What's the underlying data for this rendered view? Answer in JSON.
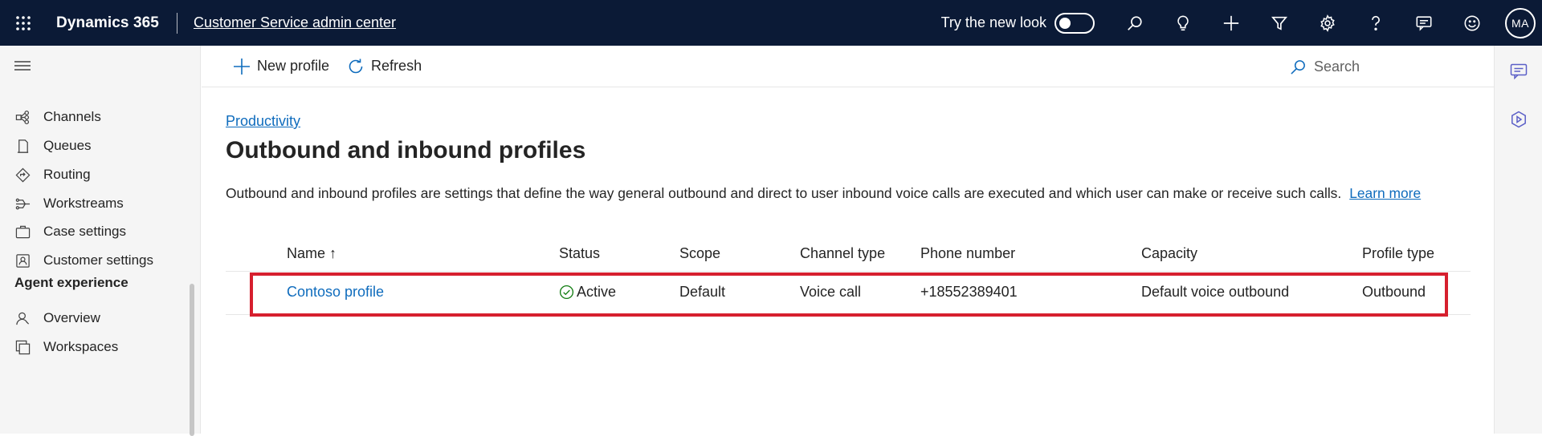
{
  "topbar": {
    "app_name": "Dynamics 365",
    "area_name": "Customer Service admin center",
    "try_new_look_label": "Try the new look",
    "try_new_look_on": false,
    "icons": [
      "search-icon",
      "lightbulb-icon",
      "plus-icon",
      "filter-icon",
      "settings-gear-icon",
      "help-icon",
      "chat-icon",
      "smiley-icon"
    ],
    "avatar_initials": "MA",
    "background_color": "#0b1a36"
  },
  "sidebar": {
    "items": [
      {
        "label": "Channels",
        "icon": "channels-icon"
      },
      {
        "label": "Queues",
        "icon": "queues-icon"
      },
      {
        "label": "Routing",
        "icon": "routing-icon"
      },
      {
        "label": "Workstreams",
        "icon": "workstreams-icon"
      },
      {
        "label": "Case settings",
        "icon": "case-settings-icon"
      },
      {
        "label": "Customer settings",
        "icon": "customer-settings-icon"
      }
    ],
    "section_agent_experience": "Agent experience",
    "agent_items": [
      {
        "label": "Overview",
        "icon": "overview-icon"
      },
      {
        "label": "Workspaces",
        "icon": "workspaces-icon"
      }
    ]
  },
  "commandbar": {
    "new_profile_label": "New profile",
    "refresh_label": "Refresh",
    "search_placeholder": "Search"
  },
  "main": {
    "breadcrumb": "Productivity",
    "title": "Outbound and inbound profiles",
    "description": "Outbound and inbound profiles are settings that define the way general outbound and direct to user inbound voice calls are executed and which user can make or receive such calls.",
    "learn_more": "Learn more"
  },
  "grid": {
    "columns": [
      "Name ↑",
      "Status",
      "Scope",
      "Channel type",
      "Phone number",
      "Capacity",
      "Profile type"
    ],
    "rows": [
      {
        "name": "Contoso profile",
        "status": "Active",
        "scope": "Default",
        "channel_type": "Voice call",
        "phone_number": "+18552389401",
        "capacity": "Default voice outbound",
        "profile_type": "Outbound"
      }
    ]
  },
  "colors": {
    "link": "#0f6cbd",
    "highlight": "#d61f2e",
    "status_active": "#107c10"
  }
}
